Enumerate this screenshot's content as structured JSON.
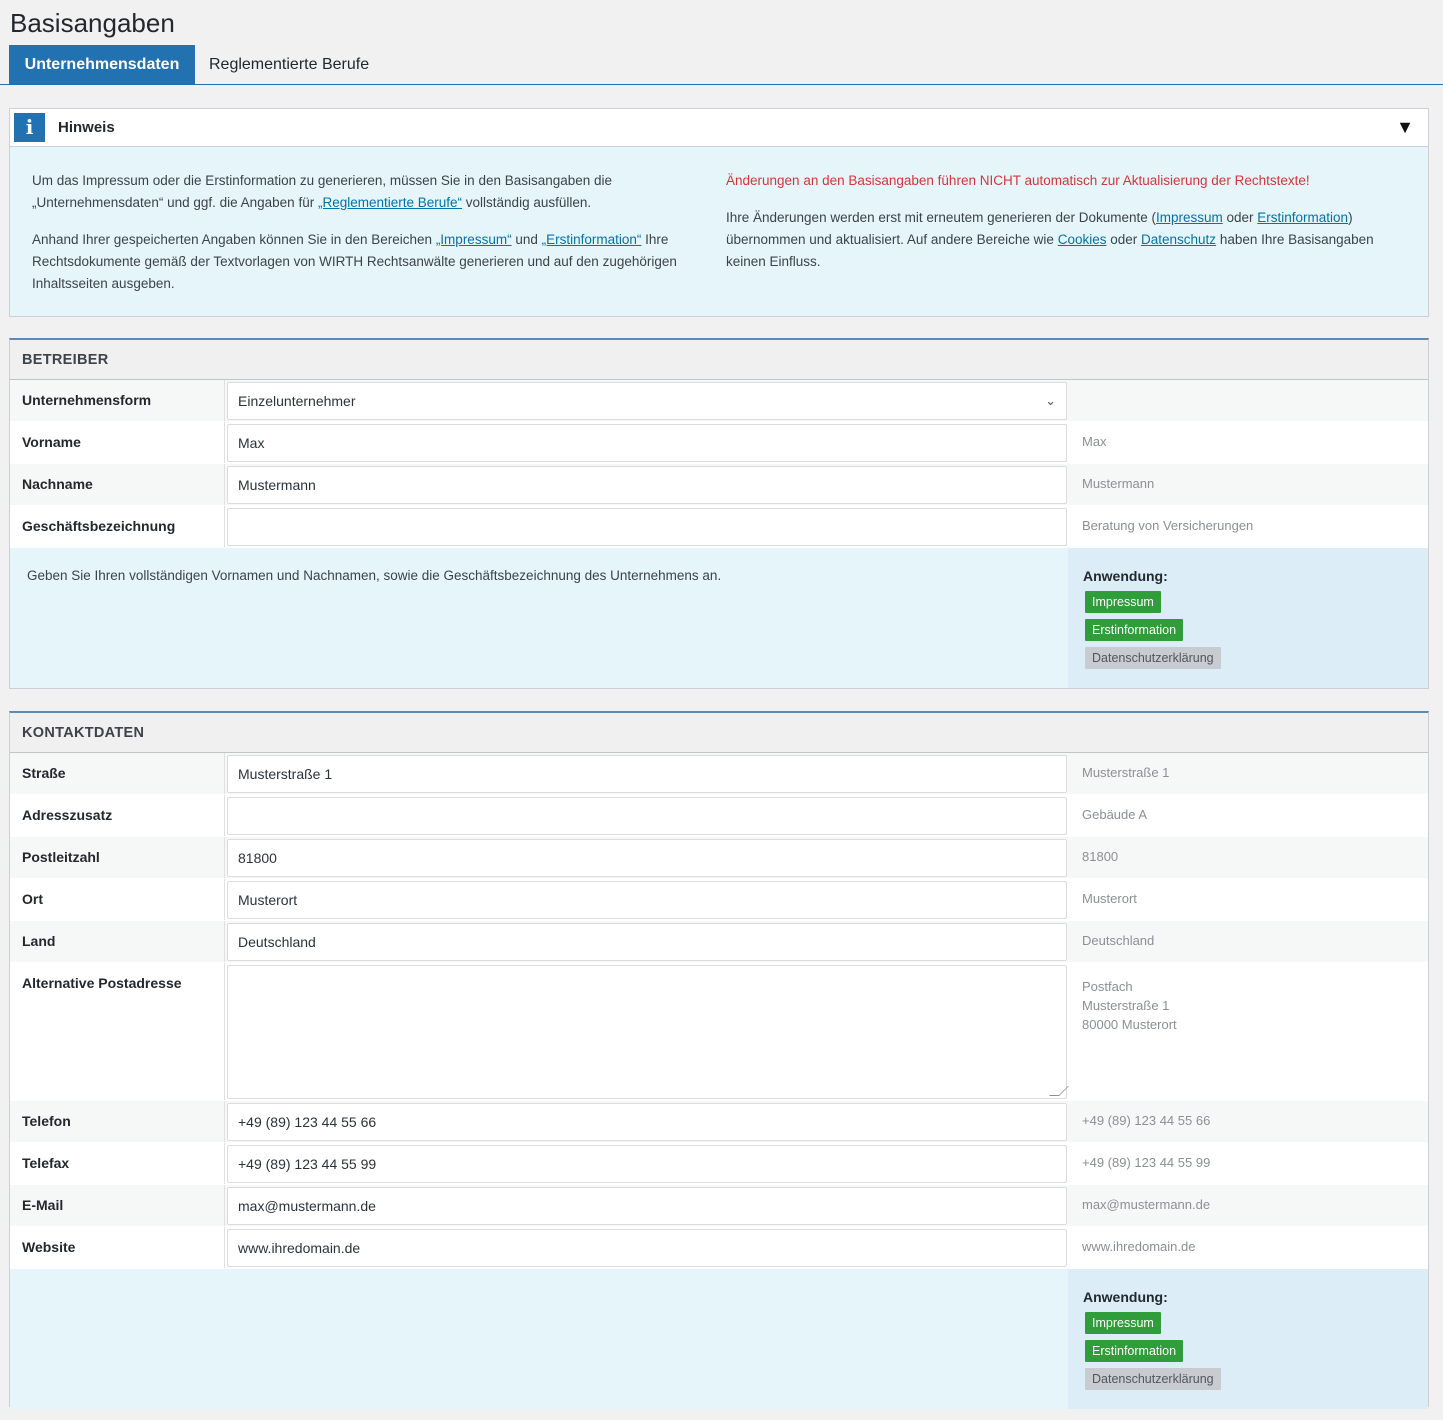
{
  "page": {
    "title": "Basisangaben"
  },
  "tabs": [
    {
      "label": "Unternehmensdaten",
      "active": true
    },
    {
      "label": "Reglementierte Berufe",
      "active": false
    }
  ],
  "notice": {
    "title": "Hinweis",
    "left_p1_a": "Um das Impressum oder die Erstinformation zu generieren, müssen Sie in den Basisangaben die „Unternehmensdaten“ und ggf. die Angaben für ",
    "left_p1_link": "„Reglementierte Berufe“",
    "left_p1_b": " vollständig ausfüllen.",
    "left_p2_a": "Anhand Ihrer gespeicherten Angaben können Sie in den Bereichen ",
    "left_p2_link1": "„Impressum“",
    "left_p2_and": " und ",
    "left_p2_link2": "„Erstinformation“",
    "left_p2_b": " Ihre Rechtsdokumente gemäß der Textvorlagen von WIRTH Rechtsanwälte generieren und auf den zugehörigen Inhaltsseiten ausgeben.",
    "warning": "Änderungen an den Basisangaben führen NICHT automatisch zur Aktualisierung der Rechtstexte!",
    "right_p_a": "Ihre Änderungen werden erst mit erneutem generieren der Dokumente (",
    "right_link1": "Impressum",
    "right_p_oder1": " oder ",
    "right_link2": "Erstinformation",
    "right_p_b": ") übernommen und aktualisiert. Auf andere Bereiche wie ",
    "right_link3": "Cookies",
    "right_p_oder2": " oder ",
    "right_link4": "Datenschutz",
    "right_p_c": " haben Ihre Basisangaben keinen Einfluss."
  },
  "betreiber": {
    "title": "BETREIBER",
    "rows": [
      {
        "label": "Unternehmensform",
        "value": "Einzelunternehmer",
        "example": ""
      },
      {
        "label": "Vorname",
        "value": "Max",
        "example": "Max"
      },
      {
        "label": "Nachname",
        "value": "Mustermann",
        "example": "Mustermann"
      },
      {
        "label": "Geschäftsbezeichnung",
        "value": "",
        "example": "Beratung von Versicherungen"
      }
    ],
    "help": "Geben Sie Ihren vollständigen Vornamen und Nachnamen, sowie die Geschäftsbezeichnung des Unternehmens an.",
    "usage_title": "Anwendung:",
    "badges": [
      "Impressum",
      "Erstinformation",
      "Datenschutzerklärung"
    ]
  },
  "kontakt": {
    "title": "KONTAKTDATEN",
    "rows": [
      {
        "label": "Straße",
        "value": "Musterstraße 1",
        "example": "Musterstraße 1"
      },
      {
        "label": "Adresszusatz",
        "value": "",
        "example": "Gebäude A"
      },
      {
        "label": "Postleitzahl",
        "value": "81800",
        "example": "81800"
      },
      {
        "label": "Ort",
        "value": "Musterort",
        "example": "Musterort"
      },
      {
        "label": "Land",
        "value": "Deutschland",
        "example": "Deutschland"
      }
    ],
    "alt_label": "Alternative Postadresse",
    "alt_value": "",
    "alt_example": [
      "Postfach",
      "Musterstraße 1",
      "80000 Musterort"
    ],
    "rows2": [
      {
        "label": "Telefon",
        "value": "+49 (89) 123 44 55 66",
        "example": "+49 (89) 123 44 55 66"
      },
      {
        "label": "Telefax",
        "value": "+49 (89) 123 44 55 99",
        "example": "+49 (89) 123 44 55 99"
      },
      {
        "label": "E-Mail",
        "value": "max@mustermann.de",
        "example": "max@mustermann.de"
      },
      {
        "label": "Website",
        "value": "www.ihredomain.de",
        "example": "www.ihredomain.de"
      }
    ],
    "usage_title": "Anwendung:",
    "badges": [
      "Impressum",
      "Erstinformation",
      "Datenschutzerklärung"
    ]
  }
}
